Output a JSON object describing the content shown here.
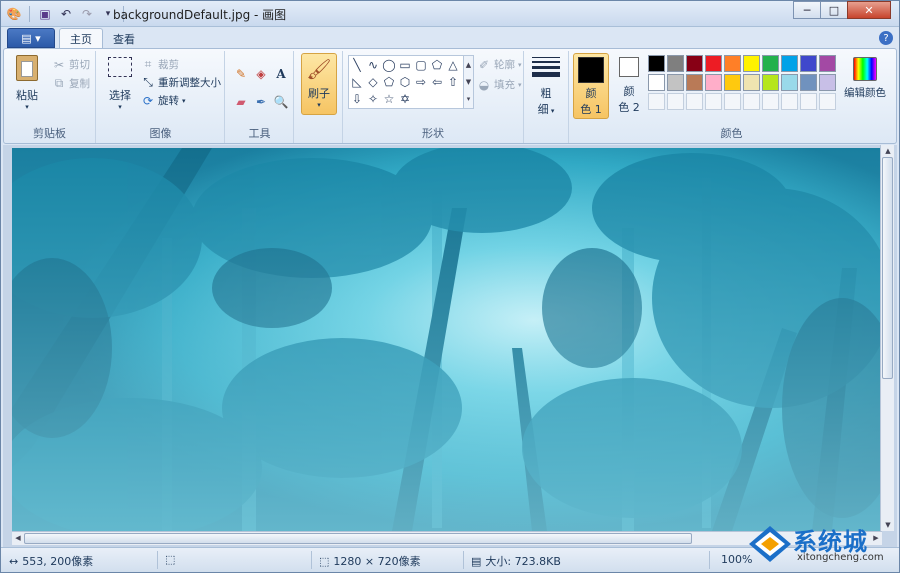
{
  "window": {
    "title": "backgroundDefault.jpg - 画图"
  },
  "quick_access": {
    "app_icon": "paint-palette-icon",
    "save_icon": "save-icon",
    "undo_icon": "undo-icon",
    "redo_icon": "redo-icon",
    "customize_icon": "dropdown-icon"
  },
  "window_controls": {
    "minimize": "─",
    "maximize": "□",
    "close": "✕"
  },
  "tabs": {
    "file_label": "▤ ▾",
    "home": "主页",
    "view": "查看"
  },
  "ribbon": {
    "clipboard": {
      "group_label": "剪贴板",
      "paste": "粘贴",
      "cut": "剪切",
      "copy": "复制"
    },
    "image": {
      "group_label": "图像",
      "select": "选择",
      "crop": "裁剪",
      "resize": "重新调整大小",
      "rotate": "旋转"
    },
    "tools": {
      "group_label": "工具"
    },
    "brushes": {
      "label": "刷子"
    },
    "shapes": {
      "group_label": "形状",
      "outline": "轮廓",
      "fill": "填充"
    },
    "size": {
      "label_line1": "粗",
      "label_line2": "细"
    },
    "colors": {
      "group_label": "颜色",
      "color1_line1": "颜",
      "color1_line2": "色 1",
      "color2_line1": "颜",
      "color2_line2": "色 2",
      "edit_colors": "编辑颜色",
      "color1_value": "#000000",
      "color2_value": "#ffffff",
      "palette_row1": [
        "#000000",
        "#7f7f7f",
        "#880015",
        "#ed1c24",
        "#ff7f27",
        "#fff200",
        "#22b14c",
        "#00a2e8",
        "#3f48cc",
        "#a349a4"
      ],
      "palette_row2": [
        "#ffffff",
        "#c3c3c3",
        "#b97a57",
        "#ffaec9",
        "#ffc90e",
        "#efe4b0",
        "#b5e61d",
        "#99d9ea",
        "#7092be",
        "#c8bfe7"
      ]
    }
  },
  "status": {
    "cursor_pos": "553, 200像素",
    "image_size": "1280 × 720像素",
    "file_size": "大小: 723.8KB",
    "zoom": "100%"
  },
  "watermark": {
    "brand": "系统城",
    "url": "xitongcheng.com"
  }
}
